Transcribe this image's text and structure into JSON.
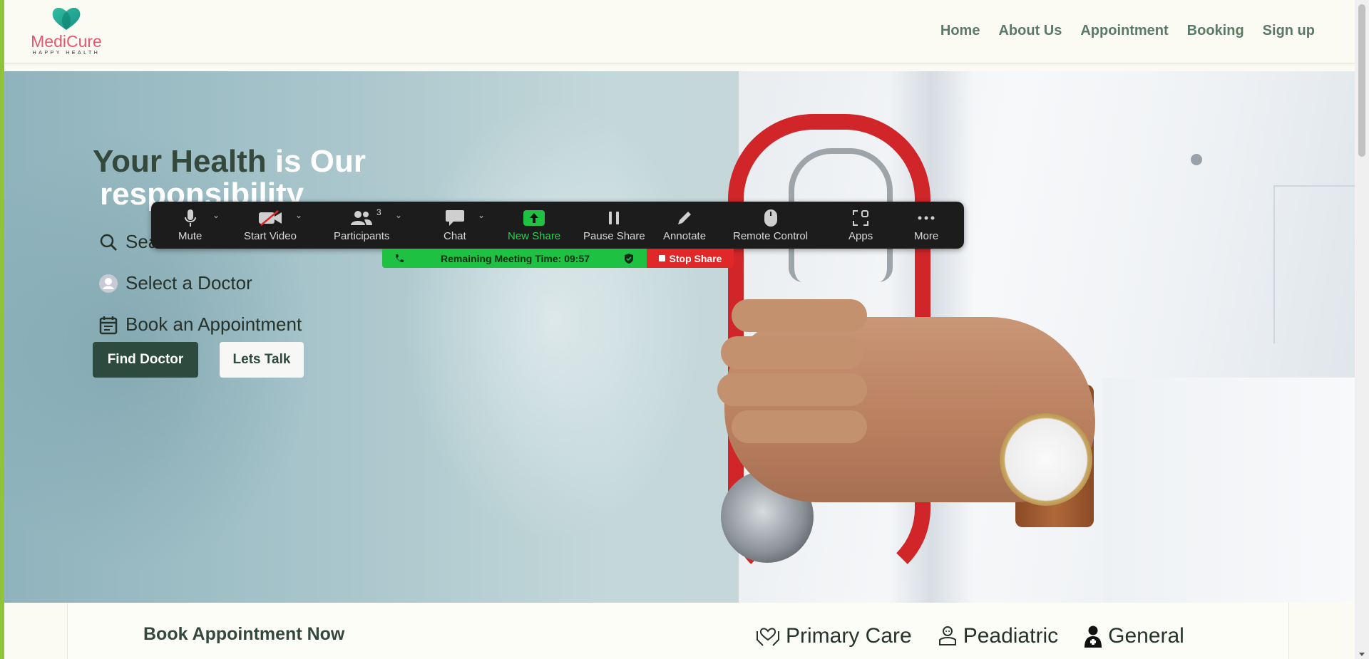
{
  "logo": {
    "name": "MediCure",
    "tagline": "HAPPY HEALTH"
  },
  "nav": {
    "items": [
      {
        "label": "Home"
      },
      {
        "label": "About Us"
      },
      {
        "label": "Appointment"
      },
      {
        "label": "Booking"
      },
      {
        "label": "Sign up"
      }
    ]
  },
  "hero": {
    "title_dark": "Your Health",
    "title_light_1": " is Our",
    "title_light_2": "responsibility",
    "features": [
      {
        "label": "Search",
        "icon": "search-icon"
      },
      {
        "label": "Select a Doctor",
        "icon": "user-icon"
      },
      {
        "label": "Book an Appointment",
        "icon": "calendar-icon"
      }
    ],
    "find_doctor": "Find Doctor",
    "lets_talk": "Lets Talk"
  },
  "bottom": {
    "book_now": "Book Appointment Now",
    "categories": [
      {
        "label": "Primary Care",
        "icon": "hands-heart-icon"
      },
      {
        "label": "Peadiatric",
        "icon": "baby-care-icon"
      },
      {
        "label": "General",
        "icon": "doctor-icon"
      }
    ]
  },
  "zoom": {
    "mute": "Mute",
    "start_video": "Start Video",
    "participants": "Participants",
    "participants_count": "3",
    "chat": "Chat",
    "new_share": "New Share",
    "pause_share": "Pause Share",
    "annotate": "Annotate",
    "remote_control": "Remote Control",
    "apps": "Apps",
    "more": "More",
    "remaining": "Remaining Meeting Time: 09:57",
    "stop_share": "Stop Share"
  },
  "colors": {
    "brand_pink": "#e4576e",
    "nav_green": "#5a7a63",
    "dark_green": "#2d4a3e",
    "zoom_green": "#1fc142",
    "zoom_red": "#e02828"
  }
}
